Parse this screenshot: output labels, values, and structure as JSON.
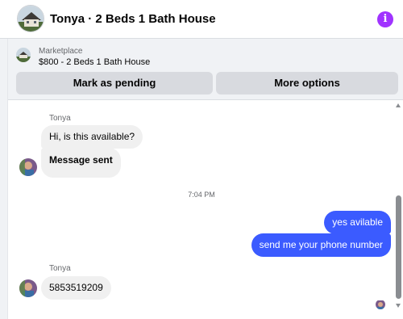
{
  "header": {
    "title": "Tonya · 2 Beds 1 Bath House",
    "avatar_icon": "house-photo-avatar",
    "info_icon": "info-icon",
    "accent_color": "#a033ff"
  },
  "marketplace": {
    "label": "Marketplace",
    "listing": "$800 - 2 Beds 1 Bath House",
    "pending_button": "Mark as pending",
    "more_button": "More options"
  },
  "chat": {
    "outgoing_color": "#3b5bff",
    "groups": [
      {
        "sender": "Tonya",
        "messages": [
          "Hi, is this available?",
          "Message sent"
        ]
      },
      {
        "timestamp": "7:04 PM"
      },
      {
        "sender": "me",
        "messages": [
          "yes avilable",
          "send me your phone number"
        ]
      },
      {
        "sender": "Tonya",
        "messages": [
          "5853519209"
        ]
      }
    ],
    "sender_name_1": "Tonya",
    "msg_hi": "Hi, is this available?",
    "msg_sent": "Message sent",
    "timestamp": "7:04 PM",
    "msg_yes": "yes avilable",
    "msg_phone": "send me your phone number",
    "sender_name_2": "Tonya",
    "msg_number": "5853519209"
  }
}
